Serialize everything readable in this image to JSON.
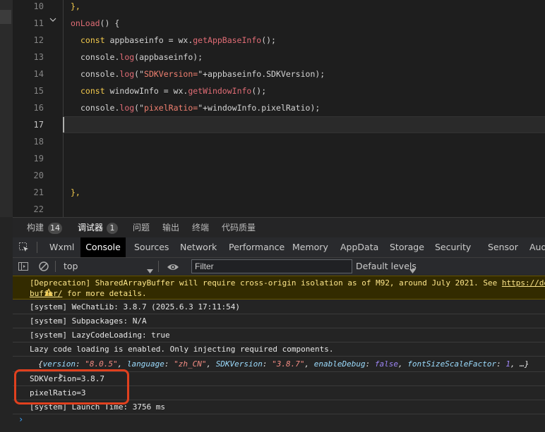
{
  "editor": {
    "line_numbers": [
      "10",
      "11",
      "12",
      "13",
      "14",
      "15",
      "16",
      "17",
      "18",
      "19",
      "20",
      "21",
      "22"
    ],
    "active_line": "17",
    "code": {
      "l10": "},",
      "l11_fn": "onLoad",
      "l11_rest": "() {",
      "l12_kw": "const",
      "l12_var": " appbaseinfo = wx.",
      "l12_fn": "getAppBaseInfo",
      "l12_end": "();",
      "l13_a": "console.",
      "l13_fn": "log",
      "l13_b": "(appbaseinfo);",
      "l14_a": "console.",
      "l14_fn": "log",
      "l14_b": "(\"",
      "l14_str": "SDKVersion=",
      "l14_c": "\"+appbaseinfo.SDKVersion);",
      "l15_kw": "const",
      "l15_var": " windowInfo = wx.",
      "l15_fn": "getWindowInfo",
      "l15_end": "();",
      "l16_a": "console.",
      "l16_fn": "log",
      "l16_b": "(\"",
      "l16_str": "pixelRatio=",
      "l16_c": "\"+windowInfo.pixelRatio);",
      "l21": "},"
    }
  },
  "panel_tabs": [
    {
      "label": "构建",
      "badge": "14"
    },
    {
      "label": "调试器",
      "badge": "1"
    },
    {
      "label": "问题"
    },
    {
      "label": "输出"
    },
    {
      "label": "终端"
    },
    {
      "label": "代码质量"
    }
  ],
  "devtools_tabs": [
    "Wxml",
    "Console",
    "Sources",
    "Network",
    "Performance",
    "Memory",
    "AppData",
    "Storage",
    "Security",
    "Sensor",
    "Aud"
  ],
  "toolbar": {
    "context": "top",
    "filter_placeholder": "Filter",
    "levels": "Default levels"
  },
  "console": {
    "warn_icon": "warning-icon",
    "warn_prefix": "[Deprecation] SharedArrayBuffer will require cross-origin isolation as of M92, around July 2021. See ",
    "warn_link1": "https://de",
    "warn_link2": "buffer/",
    "warn_suffix": " for more details.",
    "line1": "[system] WeChatLib: 3.8.7 (2025.6.3 17:11:54)",
    "line2": "[system] Subpackages: N/A",
    "line3": "[system] LazyCodeLoading: true",
    "line4": "Lazy code loading is enabled. Only injecting required components.",
    "obj": {
      "k1": "version",
      "v1": "\"8.0.5\"",
      "k2": "language",
      "v2": "\"zh_CN\"",
      "k3": "SDKVersion",
      "v3": "\"3.8.7\"",
      "k4": "enableDebug",
      "v4": "false",
      "k5": "fontSizeScaleFactor",
      "v5": "1",
      "tail": ", …}"
    },
    "line5": "SDKVersion=3.8.7",
    "line6": "pixelRatio=3",
    "line7": "[system] Launch Time: 3756 ms",
    "prompt": "›"
  },
  "colors": {
    "highlight_box": "#e0401e",
    "warning_bg": "#332b00",
    "accent": "#3ea6ff"
  }
}
